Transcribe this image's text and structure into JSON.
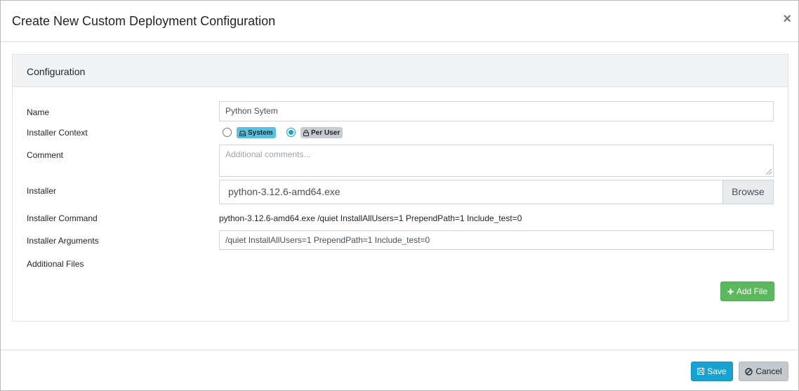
{
  "modal": {
    "title": "Create New Custom Deployment Configuration",
    "close_glyph": "×"
  },
  "card": {
    "header": "Configuration"
  },
  "form": {
    "name": {
      "label": "Name",
      "value": "Python Sytem"
    },
    "installer_context": {
      "label": "Installer Context",
      "options": [
        {
          "label": "System",
          "icon": "hdd-icon",
          "checked": false
        },
        {
          "label": "Per User",
          "icon": "lock-icon",
          "checked": true
        }
      ]
    },
    "comment": {
      "label": "Comment",
      "placeholder": "Additional comments..."
    },
    "installer": {
      "label": "Installer",
      "file": "python-3.12.6-amd64.exe",
      "browse_label": "Browse"
    },
    "installer_command": {
      "label": "Installer Command",
      "value": "python-3.12.6-amd64.exe /quiet InstallAllUsers=1 PrependPath=1 Include_test=0"
    },
    "installer_arguments": {
      "label": "Installer Arguments",
      "value": "/quiet InstallAllUsers=1 PrependPath=1 Include_test=0"
    },
    "additional_files": {
      "label": "Additional Files",
      "add_button": "Add File"
    }
  },
  "footer": {
    "save_label": "Save",
    "cancel_label": "Cancel"
  },
  "colors": {
    "info": "#17a2b8",
    "success": "#5cb85c",
    "primary": "#17a2d0"
  }
}
